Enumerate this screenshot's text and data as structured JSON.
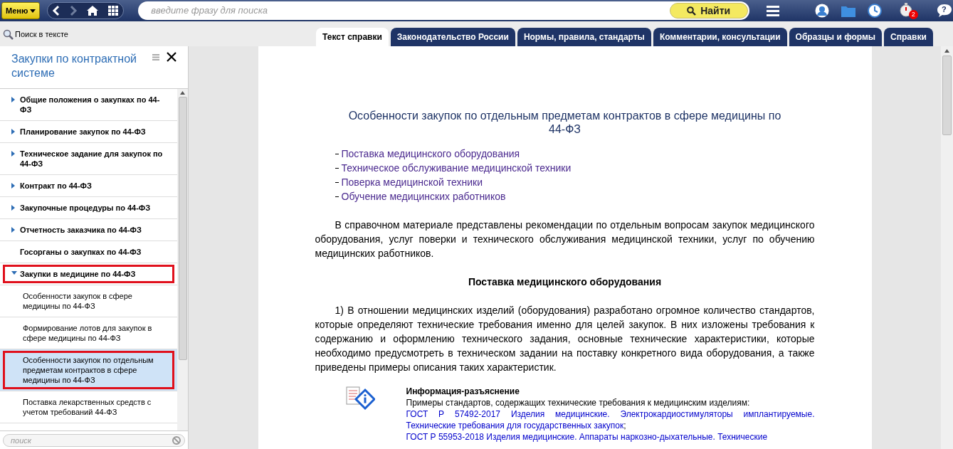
{
  "toolbar": {
    "menu_label": "Меню",
    "search": {
      "placeholder": "введите фразу для поиска"
    },
    "find_label": "Найти",
    "notification_count": "2",
    "help_label": "?"
  },
  "text_search_label": "Поиск в тексте",
  "tabs": [
    {
      "label": "Текст справки",
      "selected": true
    },
    {
      "label": "Законодательство России",
      "selected": false
    },
    {
      "label": "Нормы, правила, стандарты",
      "selected": false
    },
    {
      "label": "Комментарии, консультации",
      "selected": false
    },
    {
      "label": "Образцы и формы",
      "selected": false
    },
    {
      "label": "Справки",
      "selected": false
    }
  ],
  "sidebar": {
    "title": "Закупки по контрактной системе",
    "search": {
      "placeholder": "поиск"
    },
    "items": [
      {
        "label": "Общие положения о закупках по 44-ФЗ",
        "kind": "branch",
        "expanded": false,
        "highlighted": false
      },
      {
        "label": "Планирование закупок по 44-ФЗ",
        "kind": "branch",
        "expanded": false,
        "highlighted": false
      },
      {
        "label": "Техническое задание для закупок по 44-ФЗ",
        "kind": "branch",
        "expanded": false,
        "highlighted": false
      },
      {
        "label": "Контракт по 44-ФЗ",
        "kind": "branch",
        "expanded": false,
        "highlighted": false
      },
      {
        "label": "Закупочные процедуры по 44-ФЗ",
        "kind": "branch",
        "expanded": false,
        "highlighted": false
      },
      {
        "label": "Отчетность заказчика по 44-ФЗ",
        "kind": "branch",
        "expanded": false,
        "highlighted": false
      },
      {
        "label": "Госорганы о закупках по 44-ФЗ",
        "kind": "leaf",
        "highlighted": false
      },
      {
        "label": "Закупки в медицине по 44-ФЗ",
        "kind": "branch",
        "expanded": true,
        "highlighted": true,
        "children": [
          {
            "label": "Особенности закупок в сфере медицины по 44-ФЗ",
            "selected": false,
            "highlighted": false
          },
          {
            "label": "Формирование лотов для закупок в сфере медицины по 44-ФЗ",
            "selected": false,
            "highlighted": false
          },
          {
            "label": "Особенности закупок по отдельным предметам контрактов в сфере медицины по 44-ФЗ",
            "selected": true,
            "highlighted": true
          },
          {
            "label": "Поставка лекарственных средств с учетом требований 44-ФЗ",
            "selected": false,
            "highlighted": false
          }
        ]
      }
    ]
  },
  "document": {
    "title": "Особенности закупок по отдельным предметам контрактов в сфере медицины по 44-ФЗ",
    "contents": [
      "Поставка медицинского оборудования",
      "Техническое обслуживание медицинской техники",
      "Поверка медицинской техники",
      "Обучение медицинских работников"
    ],
    "intro": "В справочном материале представлены рекомендации по отдельным вопросам закупок медицинского оборудования, услуг поверки и технического обслуживания медицинской техники, услуг по обучению медицинских работников.",
    "section_heading": "Поставка медицинского оборудования",
    "paragraph": "1) В отношении медицинских изделий (оборудования) разработано огромное количество стандартов, которые определяют технические требования именно для целей закупок. В них изложены требования к содержанию и оформлению технического задания, основные технические характеристики, которые необходимо предусмотреть в техническом задании на поставку конкретного вида оборудования, а также приведены примеры описания таких характеристик.",
    "info": {
      "title": "Информация-разъяснение",
      "text": "Примеры стандартов, содержащих технические требования к медицинским изделиям:",
      "links": [
        {
          "text": "ГОСТ Р 57492-2017 Изделия медицинские. Электрокардиостимуляторы имплантируемые. Технические требования для государственных закупок",
          "suffix": ";"
        },
        {
          "text": "ГОСТ Р 55953-2018 Изделия медицинские. Аппараты наркозно-дыхательные. Технические"
        }
      ]
    }
  }
}
